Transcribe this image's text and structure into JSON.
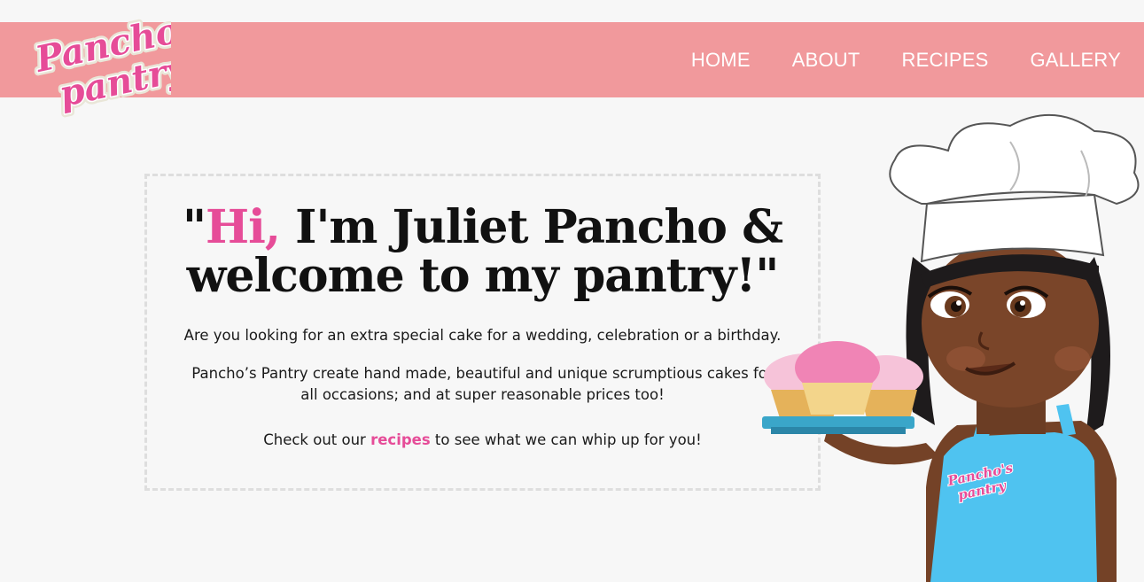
{
  "brand": {
    "logo_line1": "Pancho's",
    "logo_line2": "pantry",
    "colors": {
      "header": "#f1999c",
      "accent": "#e64c98",
      "background": "#f7f7f7",
      "apron": "#4fc3f0"
    }
  },
  "nav": {
    "items": [
      {
        "label": "HOME"
      },
      {
        "label": "ABOUT"
      },
      {
        "label": "RECIPES"
      },
      {
        "label": "GALLERY"
      }
    ]
  },
  "intro": {
    "quote_open": "\"",
    "hi": "Hi,",
    "headline_rest": " I'm Juliet Pancho &",
    "headline_line2": "welcome to my pantry!\"",
    "para1": "Are you looking for an extra special cake for a wedding, celebration or a birthday.",
    "para2": "Pancho’s Pantry create hand made, beautiful and unique scrumptious cakes for all occasions; and at super reasonable prices too!",
    "para3_before": "Check out our ",
    "para3_link": "recipes",
    "para3_after": " to see what we can whip up for you!"
  },
  "illustration": {
    "name": "chef-illustration",
    "apron_logo_line1": "Pancho's",
    "apron_logo_line2": "pantry"
  }
}
